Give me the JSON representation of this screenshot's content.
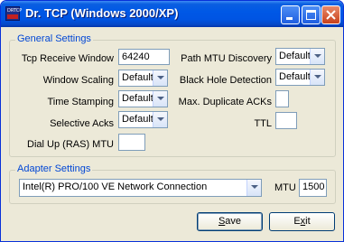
{
  "window": {
    "title": "Dr. TCP (Windows 2000/XP)"
  },
  "titlebar": {
    "minimize_icon": "minimize-icon",
    "maximize_icon": "maximize-icon",
    "close_icon": "close-icon"
  },
  "general": {
    "legend": "General Settings",
    "tcp_receive_window": {
      "label": "Tcp Receive Window",
      "value": "64240"
    },
    "window_scaling": {
      "label": "Window Scaling",
      "value": "Default"
    },
    "time_stamping": {
      "label": "Time Stamping",
      "value": "Default"
    },
    "selective_acks": {
      "label": "Selective Acks",
      "value": "Default"
    },
    "dial_up_mtu": {
      "label": "Dial Up (RAS) MTU",
      "value": ""
    },
    "path_mtu_discovery": {
      "label": "Path MTU Discovery",
      "value": "Default"
    },
    "black_hole_detection": {
      "label": "Black Hole Detection",
      "value": "Default"
    },
    "max_dup_acks": {
      "label": "Max. Duplicate ACKs",
      "value": ""
    },
    "ttl": {
      "label": "TTL",
      "value": ""
    }
  },
  "adapter": {
    "legend": "Adapter Settings",
    "adapter_value": "Intel(R) PRO/100 VE Network Connection",
    "mtu_label": "MTU",
    "mtu_value": "1500"
  },
  "buttons": {
    "save_mnemonic": "S",
    "save_rest": "ave",
    "exit_first": "E",
    "exit_mnemonic": "x",
    "exit_rest": "it"
  }
}
